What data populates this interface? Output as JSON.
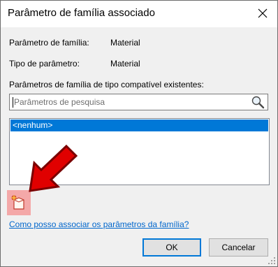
{
  "dialog": {
    "title": "Parâmetro de família associado",
    "close_icon": "close-icon"
  },
  "info": {
    "family_param_label": "Parâmetro de família:",
    "family_param_value": "Material",
    "param_type_label": "Tipo de parâmetro:",
    "param_type_value": "Material"
  },
  "existing": {
    "label": "Parâmetros de família de tipo compatível existentes:",
    "search_placeholder": "Parâmetros de pesquisa",
    "search_value": "",
    "search_icon": "search-icon",
    "items": [
      {
        "label": "<nenhum>",
        "selected": true
      }
    ]
  },
  "new_param_icon": "new-family-parameter-icon",
  "annotation": {
    "icon": "red-arrow-icon",
    "color": "#e00000"
  },
  "help_link": "Como posso associar os parâmetros da família?",
  "buttons": {
    "ok": "OK",
    "cancel": "Cancelar"
  },
  "colors": {
    "selection": "#0078d7",
    "link": "#0066cc",
    "highlight": "#f4a8a8"
  }
}
